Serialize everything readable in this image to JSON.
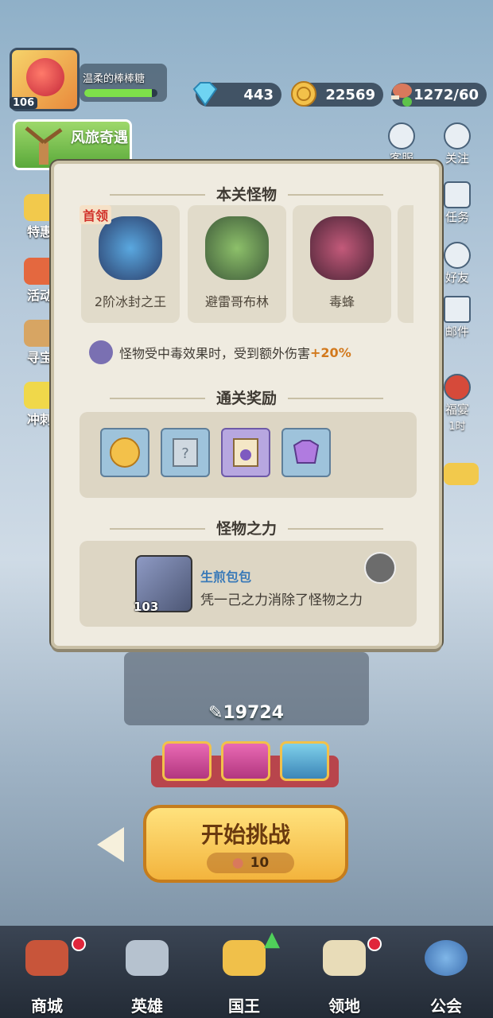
{
  "player": {
    "name": "温柔的棒棒糖",
    "level": "106",
    "xp_fraction": 0.92
  },
  "resources": {
    "diamonds": "443",
    "coins": "22569",
    "stamina": "1272/60"
  },
  "event_banner": {
    "label": "风旅奇遇"
  },
  "left_menu": [
    {
      "label": "特惠"
    },
    {
      "label": "活动"
    },
    {
      "label": "寻宝"
    },
    {
      "label": "冲刺"
    }
  ],
  "right_menu": [
    {
      "label": "客服"
    },
    {
      "label": "关注"
    },
    {
      "label": "任务"
    },
    {
      "label": "好友"
    },
    {
      "label": "邮件"
    }
  ],
  "feast": {
    "label": "福宴",
    "time": "1时"
  },
  "modal": {
    "monsters_title": "本关怪物",
    "boss_tag": "首领",
    "monsters": [
      {
        "name": "2阶冰封之王"
      },
      {
        "name": "避雷哥布林"
      },
      {
        "name": "毒蜂"
      }
    ],
    "effect_text": "怪物受中毒效果时，受到额外伤害",
    "effect_value": "+20%",
    "rewards_title": "通关奖励",
    "rewards": [
      "coin-icon",
      "scroll-icon",
      "book-icon",
      "armor-icon"
    ],
    "power_title": "怪物之力",
    "power": {
      "hero_level": "103",
      "player_name": "生煎包包",
      "description": "凭一己之力消除了怪物之力"
    }
  },
  "battle": {
    "power": "19724"
  },
  "start": {
    "label": "开始挑战",
    "cost": "10"
  },
  "nav": [
    {
      "label": "商城"
    },
    {
      "label": "英雄"
    },
    {
      "label": "国王"
    },
    {
      "label": "领地"
    },
    {
      "label": "公会"
    }
  ],
  "colors": {
    "accent": "#f3b43d",
    "effect_pct": "#d2791d",
    "boss": "#d1322a"
  }
}
